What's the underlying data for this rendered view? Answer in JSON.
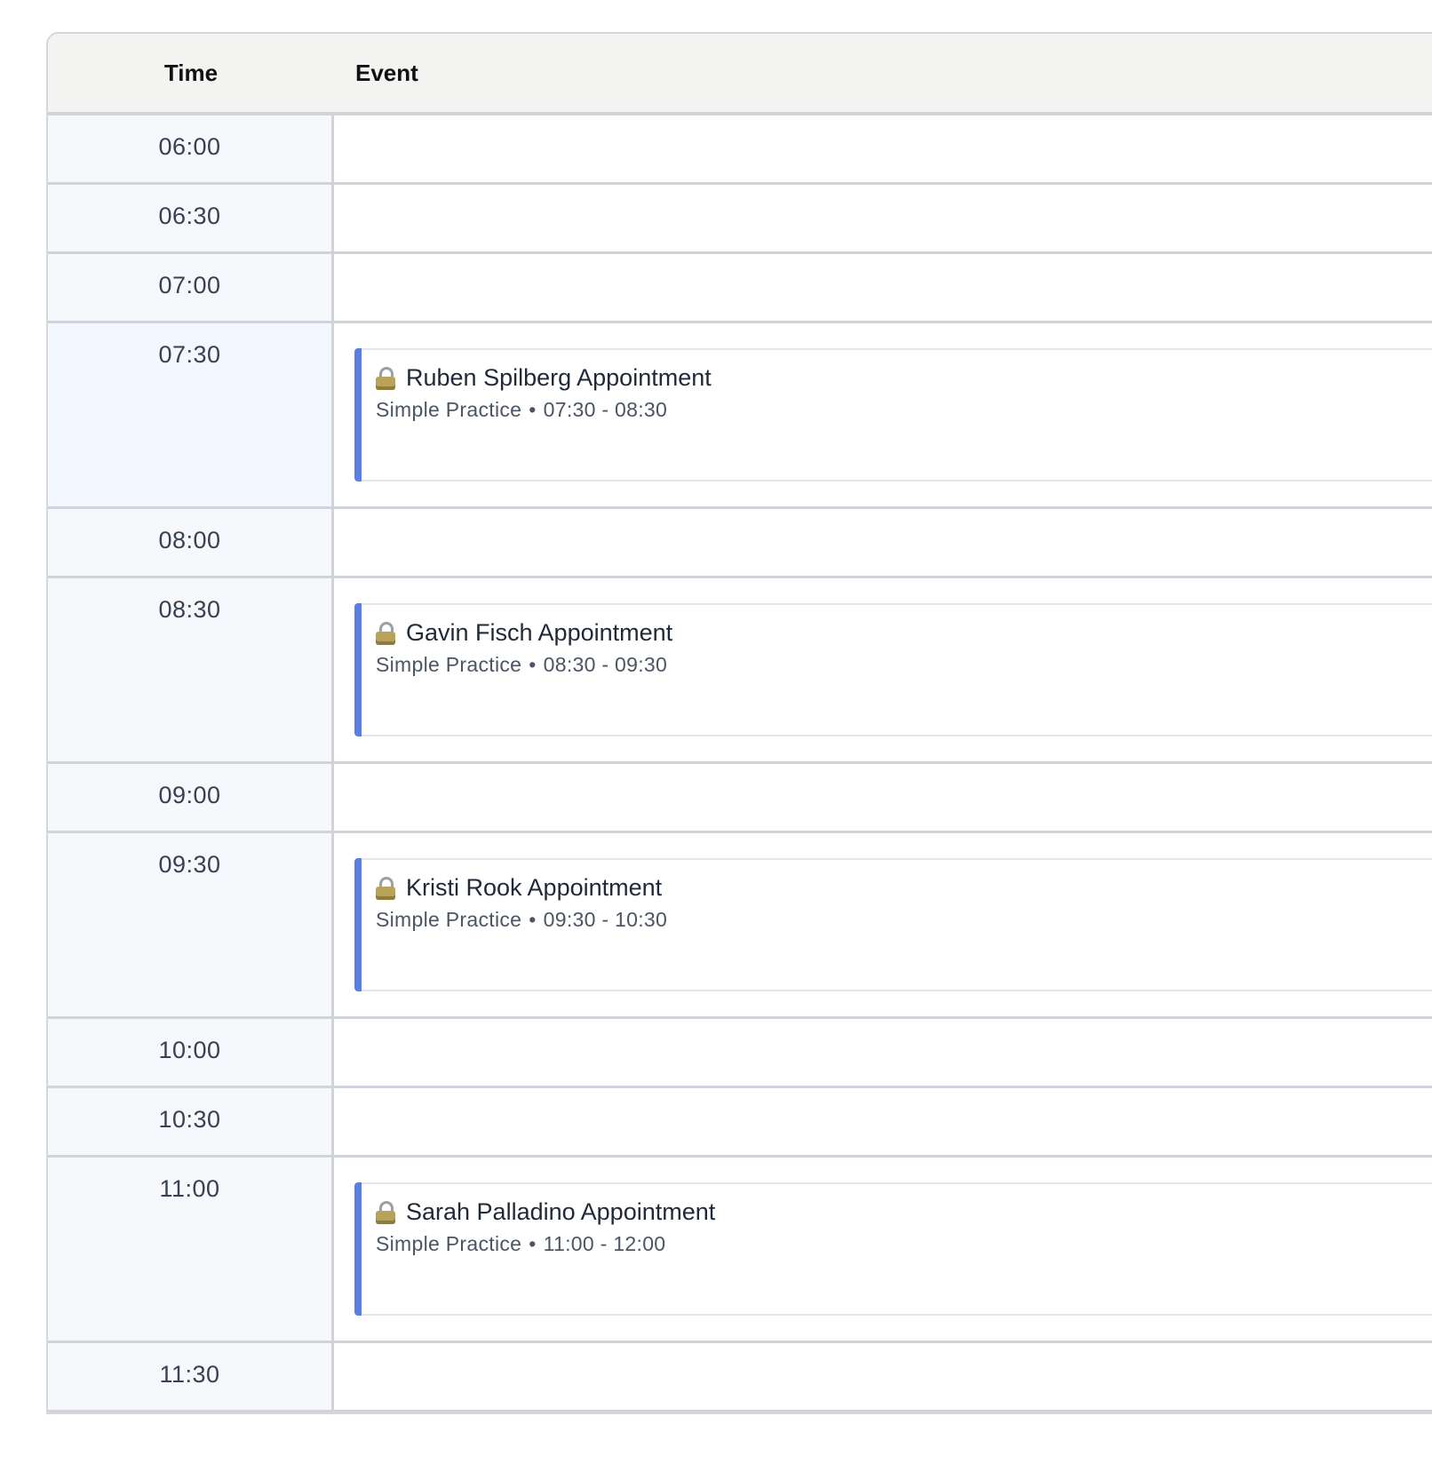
{
  "header": {
    "time_label": "Time",
    "event_label": "Event"
  },
  "event_separator": "•",
  "rows": [
    {
      "time": "06:00"
    },
    {
      "time": "06:30"
    },
    {
      "time": "07:00"
    },
    {
      "time": "07:30",
      "event": {
        "title": "Ruben Spilberg Appointment",
        "calendar": "Simple Practice",
        "range": "07:30 - 08:30",
        "icon": "lock-icon"
      }
    },
    {
      "time": "08:00"
    },
    {
      "time": "08:30",
      "event": {
        "title": "Gavin Fisch Appointment",
        "calendar": "Simple Practice",
        "range": "08:30 - 09:30",
        "icon": "lock-icon"
      }
    },
    {
      "time": "09:00"
    },
    {
      "time": "09:30",
      "event": {
        "title": "Kristi Rook Appointment",
        "calendar": "Simple Practice",
        "range": "09:30 - 10:30",
        "icon": "lock-icon"
      }
    },
    {
      "time": "10:00"
    },
    {
      "time": "10:30"
    },
    {
      "time": "11:00",
      "event": {
        "title": "Sarah Palladino Appointment",
        "calendar": "Simple Practice",
        "range": "11:00 - 12:00",
        "icon": "lock-icon"
      }
    },
    {
      "time": "11:30"
    }
  ],
  "colors": {
    "accent": "#5b7fe0",
    "header_bg": "#f3f3f2",
    "time_cell_bg": "#f6f8fb",
    "highlight_time_bg": "#f3f7ff"
  }
}
